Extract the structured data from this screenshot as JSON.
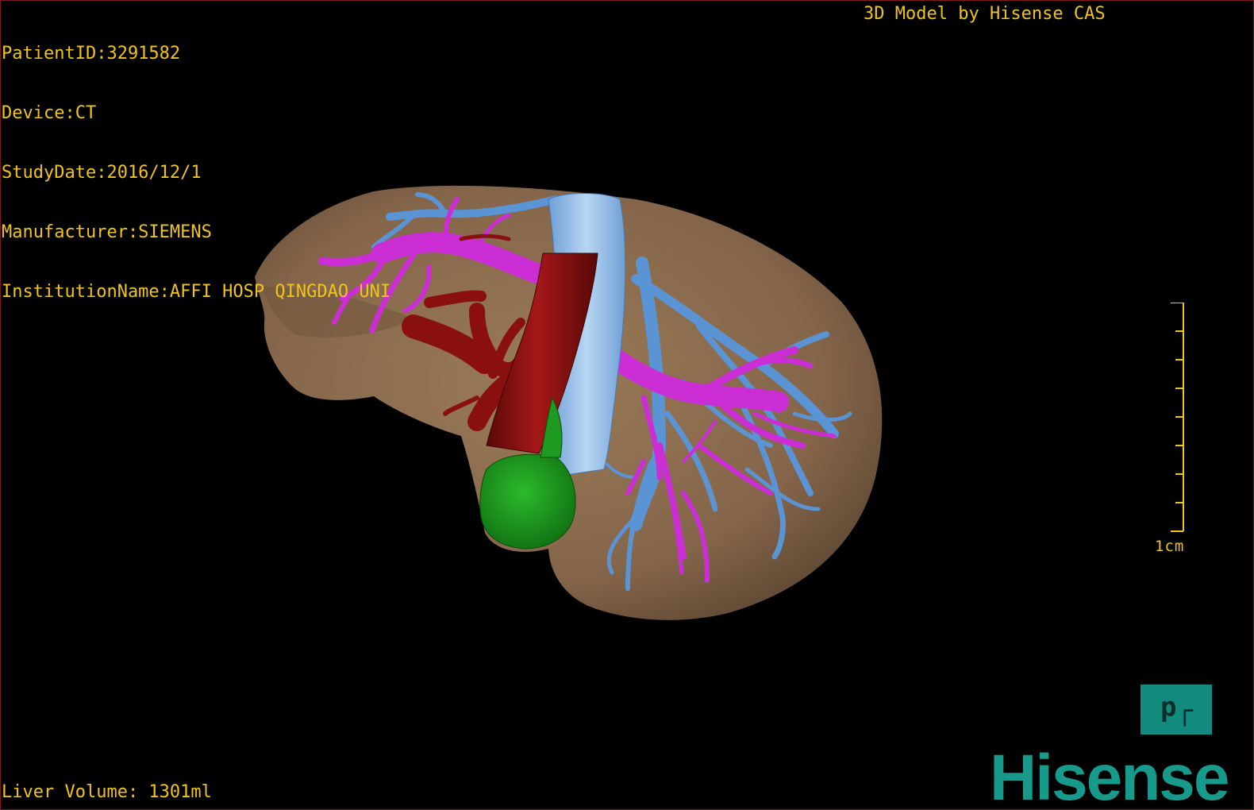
{
  "header": {
    "patient_id": "PatientID:3291582",
    "device": "Device:CT",
    "study_date": "StudyDate:2016/12/1",
    "manufacturer": "Manufacturer:SIEMENS",
    "institution": "InstitutionName:AFFI HOSP QINGDAO UNI",
    "model_credit": "3D Model by Hisense CAS"
  },
  "footer": {
    "liver_volume": "Liver Volume: 1301ml"
  },
  "scale": {
    "label": "1cm"
  },
  "orientation": {
    "label": "┘d"
  },
  "brand": {
    "logo_text": "Hisense"
  },
  "colors": {
    "overlay_text": "#f0c419",
    "liver": "#8c6d4a",
    "portal_vein": "#cc2ed6",
    "hepatic_vein": "#5a94d4",
    "vena_cava": "#8ab8e8",
    "artery": "#8a1010",
    "tumor": "#1f9a1f",
    "brand": "#17998b"
  },
  "icons": {
    "orientation": "orientation-cube-icon",
    "scale": "ruler-icon"
  }
}
